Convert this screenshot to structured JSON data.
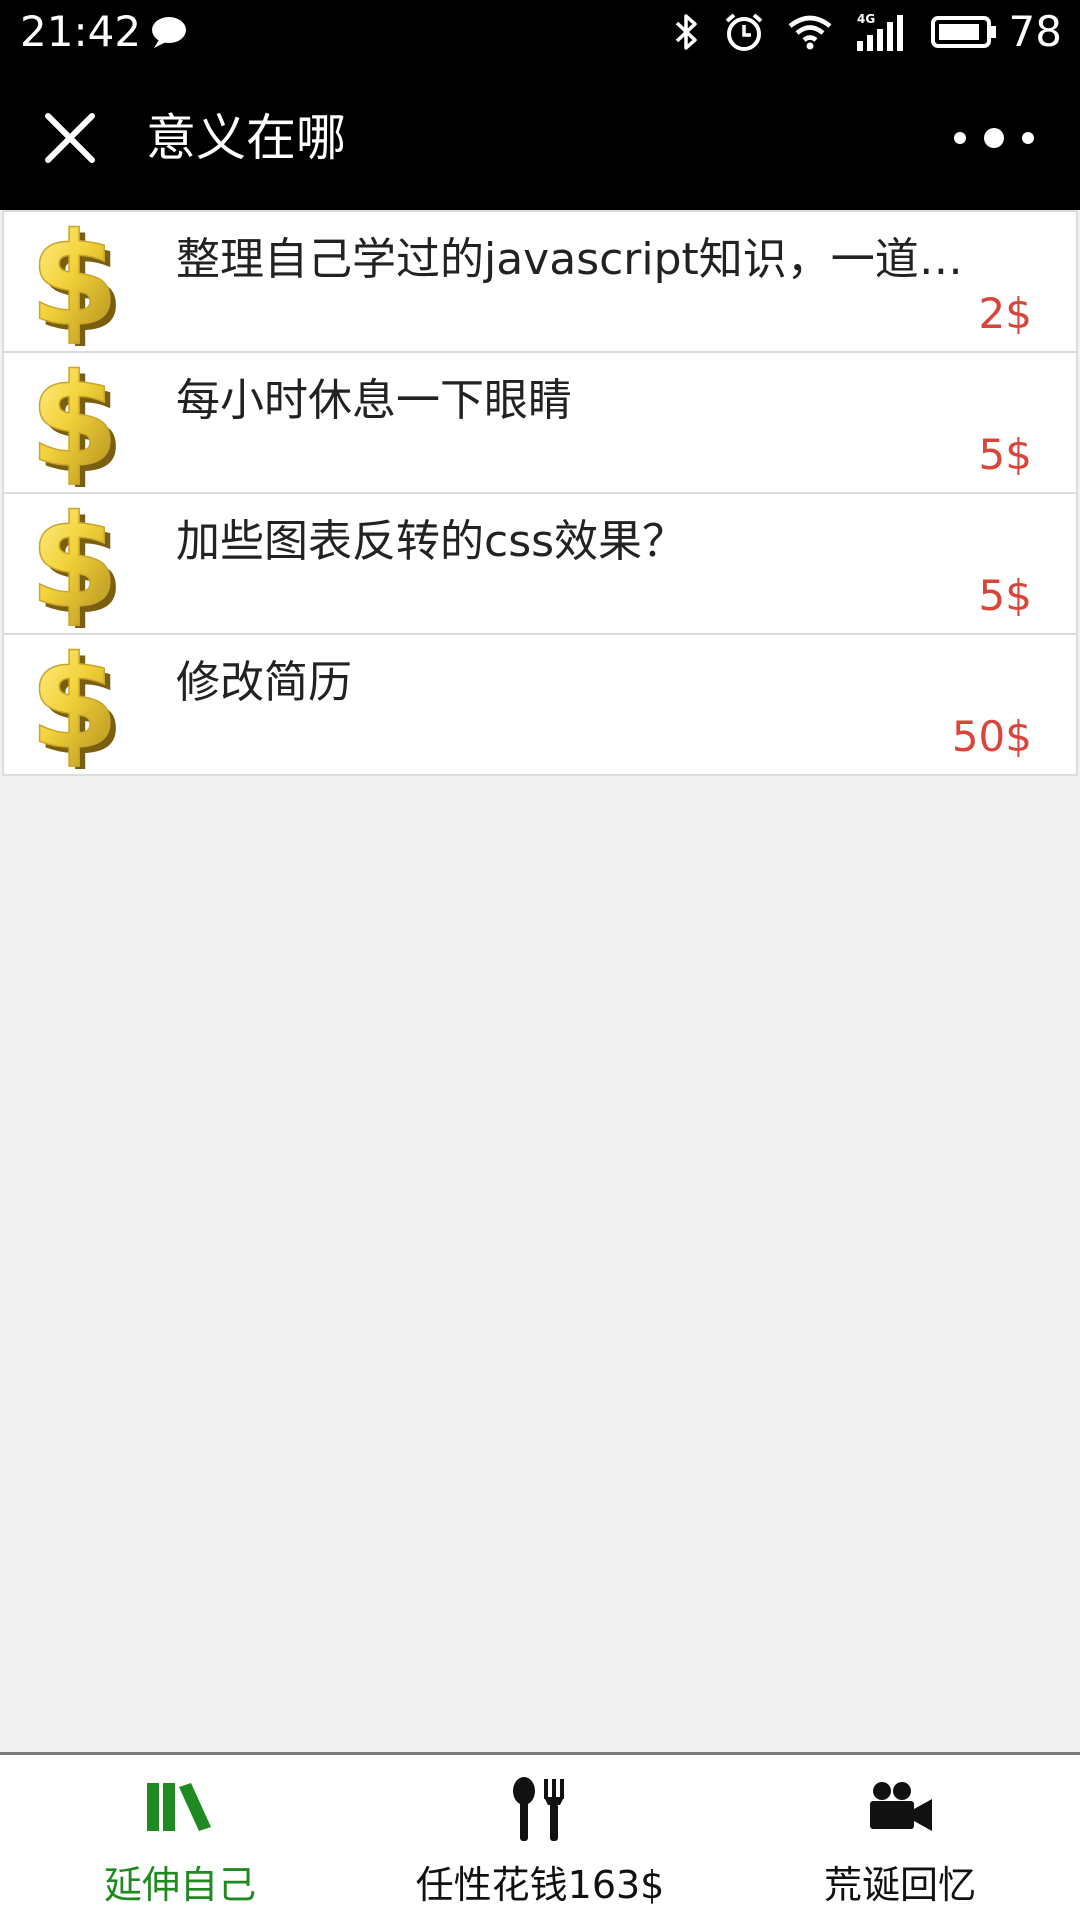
{
  "status_bar": {
    "time": "21:42",
    "battery": "78",
    "network": "4G"
  },
  "nav": {
    "title": "意义在哪"
  },
  "items": [
    {
      "title": "整理自己学过的javascript知识，一道题…",
      "price": "2$"
    },
    {
      "title": "每小时休息一下眼睛",
      "price": "5$"
    },
    {
      "title": "加些图表反转的css效果？",
      "price": "5$"
    },
    {
      "title": "修改简历",
      "price": "50$"
    }
  ],
  "tabs": [
    {
      "label": "延伸自己",
      "icon": "books-icon",
      "active": true
    },
    {
      "label": "任性花钱163$",
      "icon": "fork-spoon-icon",
      "active": false
    },
    {
      "label": "荒诞回忆",
      "icon": "video-camera-icon",
      "active": false
    }
  ],
  "colors": {
    "accent_active": "#1f8a1f",
    "price": "#d9453a",
    "background": "#f0f0f0",
    "bar": "#000000"
  }
}
